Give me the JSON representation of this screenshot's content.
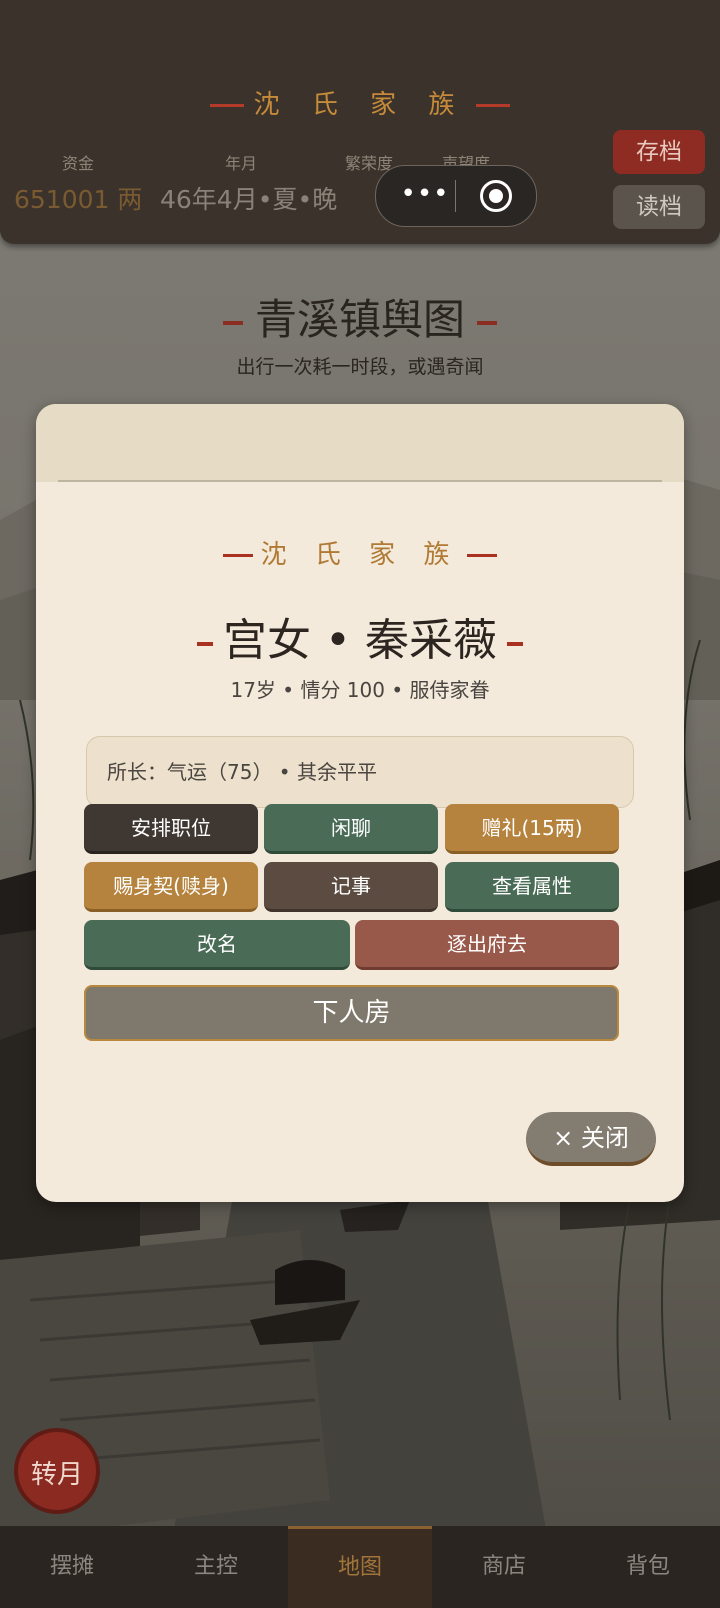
{
  "header": {
    "family_name": "沈 氏 家 族",
    "stats": [
      {
        "label": "资金",
        "value": "651001 两"
      },
      {
        "label": "年月",
        "value": "46年4月•夏•晚"
      },
      {
        "label": "繁荣度",
        "value": ""
      },
      {
        "label": "声望度",
        "value": ""
      }
    ],
    "save_label": "存档",
    "load_label": "读档",
    "capsule_menu": "•••"
  },
  "map": {
    "title": "青溪镇舆图",
    "subtitle": "出行一次耗一时段，或遇奇闻"
  },
  "modal": {
    "family": "沈 氏 家 族",
    "name": "宫女 • 秦采薇",
    "info": "17岁 • 情分 100 • 服侍家眷",
    "talent": "所长：气运（75） • 其余平平",
    "buttons": {
      "assign": "安排职位",
      "chat": "闲聊",
      "gift": "赠礼(15两)",
      "release": "赐身契(赎身)",
      "record": "记事",
      "attributes": "查看属性",
      "rename": "改名",
      "expel": "逐出府去",
      "servants_room": "下人房"
    },
    "close_icon": "×",
    "close_label": "关闭"
  },
  "month_button": "转月",
  "nav": {
    "items": [
      "摆摊",
      "主控",
      "地图",
      "商店",
      "背包"
    ],
    "active": "地图"
  },
  "colors": {
    "accent_gold": "#b5833d",
    "accent_red": "#a8321f",
    "green": "#4a6b56",
    "header_bg": "#3b332b"
  }
}
